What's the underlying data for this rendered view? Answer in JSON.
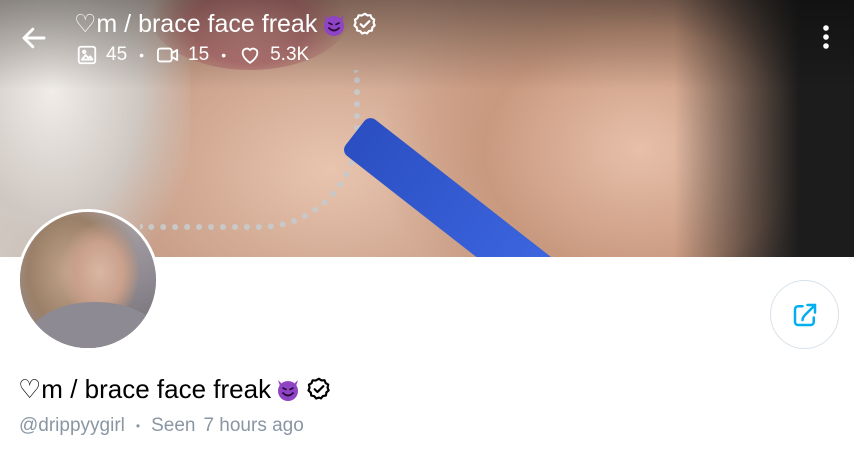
{
  "header": {
    "title": "♡m / brace face freak",
    "stats": {
      "photos": "45",
      "videos": "15",
      "likes": "5.3K"
    }
  },
  "profile": {
    "name": "♡m / brace face freak",
    "username": "@drippyygirl",
    "seen_label": "Seen",
    "seen_time": "7 hours ago"
  },
  "icons": {
    "back": "arrow-left-icon",
    "more": "more-vertical-icon",
    "photos": "image-icon",
    "videos": "video-icon",
    "likes": "heart-icon",
    "share": "share-icon",
    "verified": "verified-badge-icon",
    "emoji": "smiling-devil-emoji"
  },
  "colors": {
    "accent": "#00aff0",
    "muted_text": "#8a96a3",
    "devil_purple": "#8e44c4"
  }
}
